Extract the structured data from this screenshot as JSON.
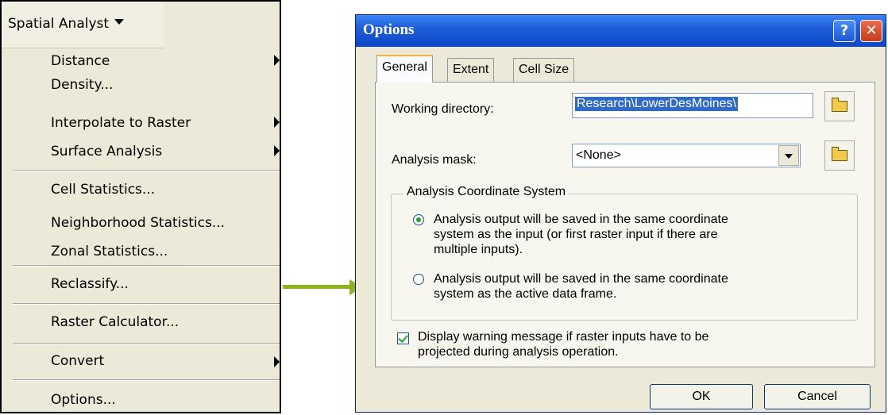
{
  "menu": {
    "title": "Spatial Analyst",
    "items": [
      {
        "label": "Distance",
        "mnemonic": "D",
        "rest": "istance",
        "has_submenu": true
      },
      {
        "label": "Density...",
        "mnemonic_pre": "D",
        "mnemonic": "e",
        "rest": "nsity...",
        "has_submenu": false
      },
      {
        "label": "Interpolate to Raster",
        "mnemonic": "I",
        "rest": "nterpolate to Raster",
        "has_submenu": true
      },
      {
        "label": "Surface Analysis",
        "mnemonic": "S",
        "rest": "urface Analysis",
        "has_submenu": true
      },
      {
        "label": "Cell Statistics...",
        "has_submenu": false
      },
      {
        "label": "Neighborhood Statistics...",
        "has_submenu": false
      },
      {
        "label": "Zonal Statistics...",
        "has_submenu": false
      },
      {
        "label": "Reclassify...",
        "has_submenu": false
      },
      {
        "label": "Raster Calculator...",
        "has_submenu": false
      },
      {
        "label": "Convert",
        "has_submenu": true
      },
      {
        "label": "Options...",
        "has_submenu": false
      }
    ]
  },
  "dialog": {
    "title": "Options",
    "help_glyph": "?",
    "close_glyph": "✕",
    "tabs": [
      "General",
      "Extent",
      "Cell Size"
    ],
    "active_tab": "General",
    "working_directory_label": "Working directory:",
    "working_directory_value": "Research\\LowerDesMoines\\",
    "analysis_mask_label": "Analysis mask:",
    "analysis_mask_value": "<None>",
    "coord_group_label": "Analysis Coordinate System",
    "radio_options": [
      {
        "line1": "Analysis output will be saved in the same coordinate",
        "line2": "system as the input (or first raster input if there are",
        "line3": "multiple inputs).",
        "selected": true
      },
      {
        "line1": "Analysis output will be saved in the same coordinate",
        "line2": "system as the active data frame.",
        "selected": false
      }
    ],
    "warning_check_line1": "Display warning message if raster inputs have to be",
    "warning_check_line2": "projected during analysis operation.",
    "warning_checked": true,
    "ok_label": "OK",
    "cancel_label": "Cancel"
  },
  "colors": {
    "titlebar": "#0b47c8",
    "arrow": "#8fb31f",
    "selection": "#316ac5"
  }
}
